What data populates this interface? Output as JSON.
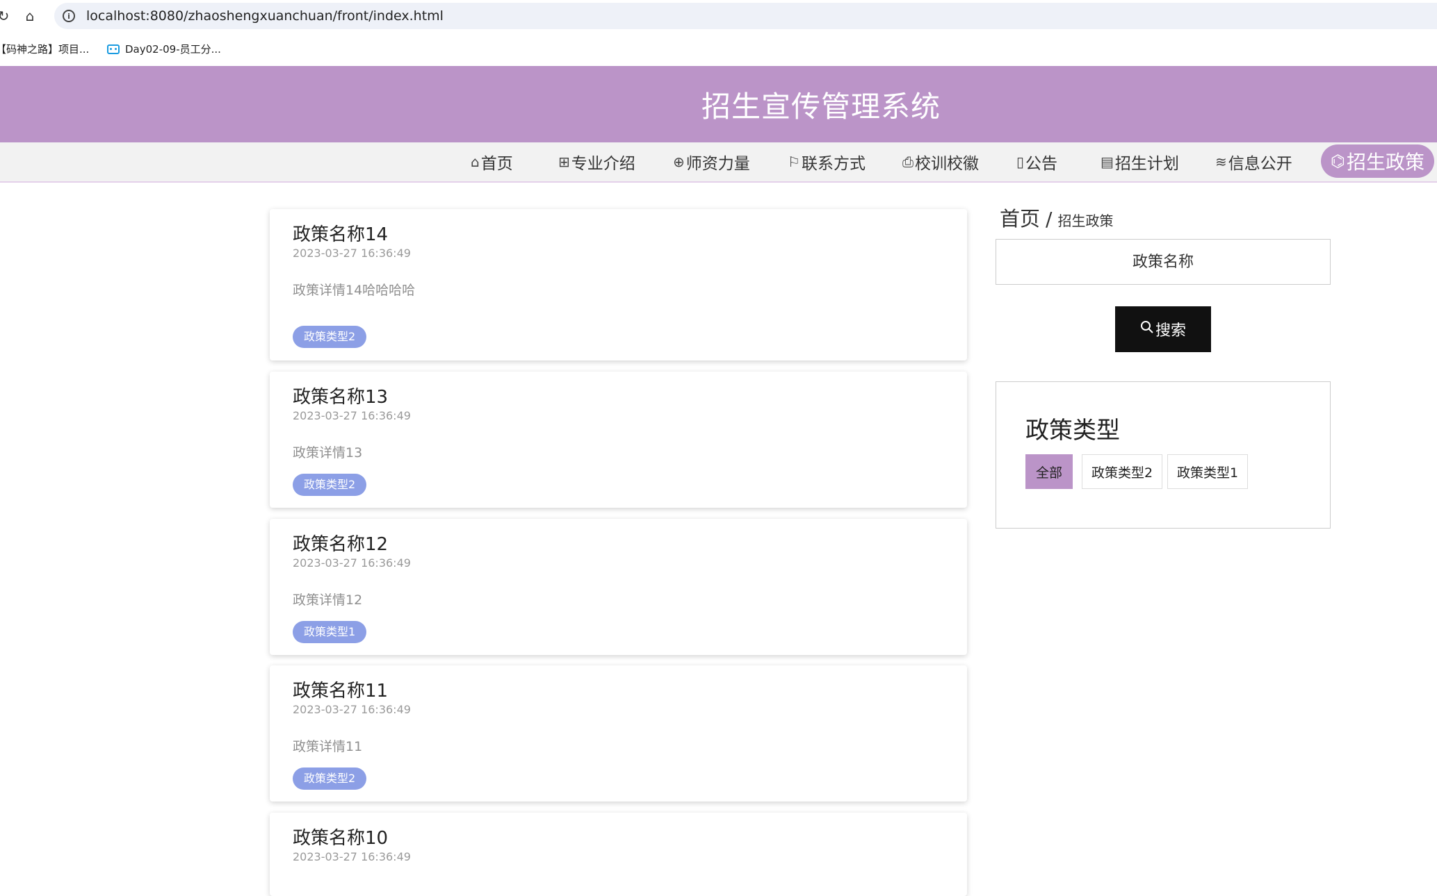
{
  "browser": {
    "url": "localhost:8080/zhaoshengxuanchuan/front/index.html",
    "bookmarks": [
      "【码神之路】项目...",
      "Day02-09-员工分..."
    ]
  },
  "header": {
    "title": "招生宣传管理系统"
  },
  "nav": {
    "items": [
      {
        "label": "首页",
        "icon": "⌂"
      },
      {
        "label": "专业介绍",
        "icon": "⊞"
      },
      {
        "label": "师资力量",
        "icon": "⊕"
      },
      {
        "label": "联系方式",
        "icon": "⚐"
      },
      {
        "label": "校训校徽",
        "icon": "⎙"
      },
      {
        "label": "公告",
        "icon": "▯"
      },
      {
        "label": "招生计划",
        "icon": "▤"
      },
      {
        "label": "信息公开",
        "icon": "≋"
      },
      {
        "label": "招生政策",
        "icon": "⌬"
      }
    ]
  },
  "policies": [
    {
      "title": "政策名称14",
      "date": "2023-03-27 16:36:49",
      "detail": "政策详情14哈哈哈哈",
      "tag": "政策类型2"
    },
    {
      "title": "政策名称13",
      "date": "2023-03-27 16:36:49",
      "detail": "政策详情13",
      "tag": "政策类型2"
    },
    {
      "title": "政策名称12",
      "date": "2023-03-27 16:36:49",
      "detail": "政策详情12",
      "tag": "政策类型1"
    },
    {
      "title": "政策名称11",
      "date": "2023-03-27 16:36:49",
      "detail": "政策详情11",
      "tag": "政策类型2"
    },
    {
      "title": "政策名称10",
      "date": "2023-03-27 16:36:49"
    }
  ],
  "breadcrumb": {
    "home": "首页",
    "sep": "/",
    "current": "招生政策"
  },
  "search": {
    "placeholder": "政策名称",
    "button": "搜索"
  },
  "types": {
    "title": "政策类型",
    "options": [
      "全部",
      "政策类型2",
      "政策类型1"
    ]
  }
}
